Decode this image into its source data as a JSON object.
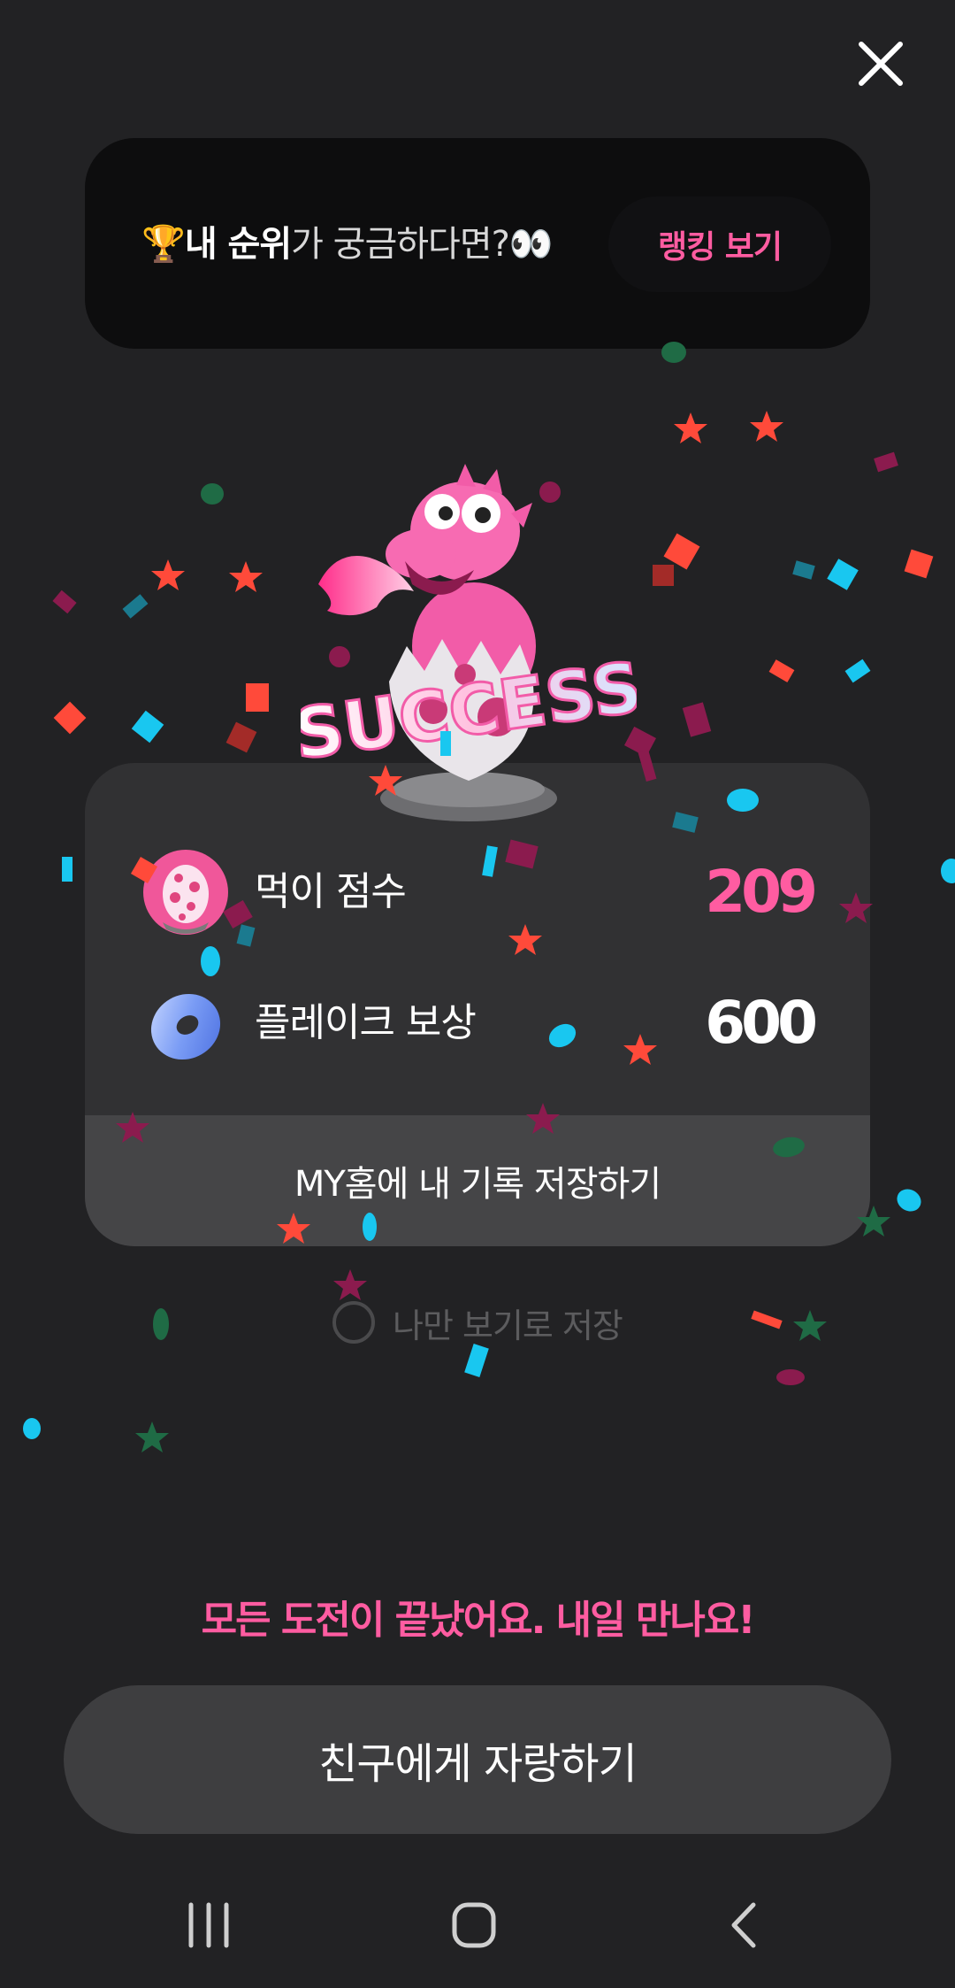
{
  "rank_banner": {
    "trophy": "🏆",
    "highlight": "내 순위",
    "question": "가 궁금하다면?",
    "eyes": "👀",
    "button_label": "랭킹 보기"
  },
  "mascot": {
    "success_text": "SUCCESS"
  },
  "results": {
    "score": {
      "label": "먹이 점수",
      "value": "209",
      "icon": "egg-icon"
    },
    "reward": {
      "label": "플레이크 보상",
      "value": "600",
      "icon": "donut-icon"
    }
  },
  "save_record_button": "MY홈에 내 기록 저장하기",
  "private_save_label": "나만 보기로 저장",
  "end_message": "모든 도전이 끝났어요. 내일 만나요!",
  "share_button": "친구에게 자랑하기",
  "colors": {
    "accent_pink": "#ff5ca1",
    "background": "#222224",
    "card": "#313133",
    "banner": "#0d0d0e"
  }
}
